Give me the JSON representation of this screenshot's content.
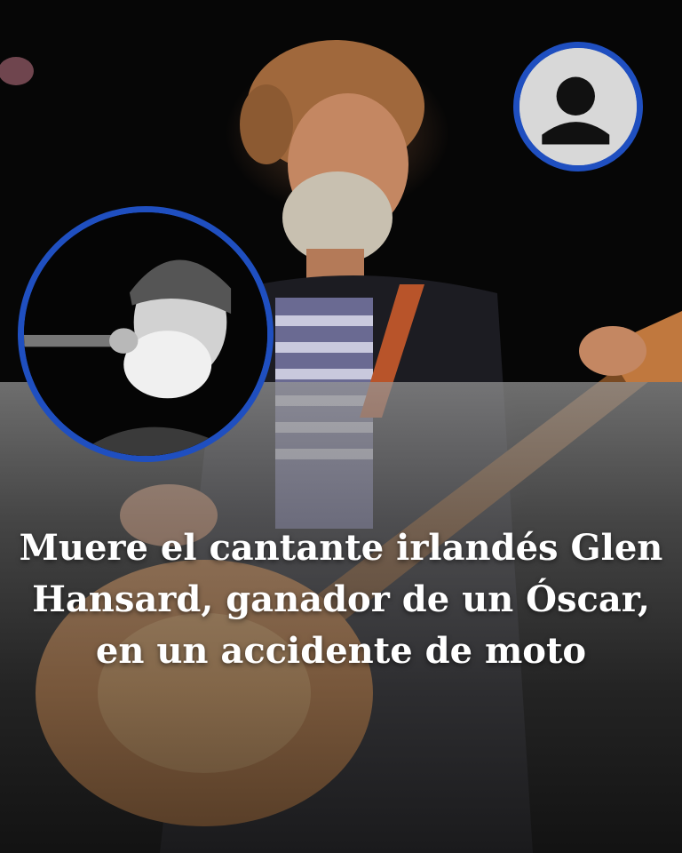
{
  "headline": "Muere el cantante irlandés Glen Hansard, ganador de un Óscar, en un accidente de moto",
  "colors": {
    "ring": "#1f4fc0",
    "overlay": "#8c8c8c",
    "text": "#ffffff"
  },
  "icons": {
    "profile": "person-silhouette-icon"
  }
}
